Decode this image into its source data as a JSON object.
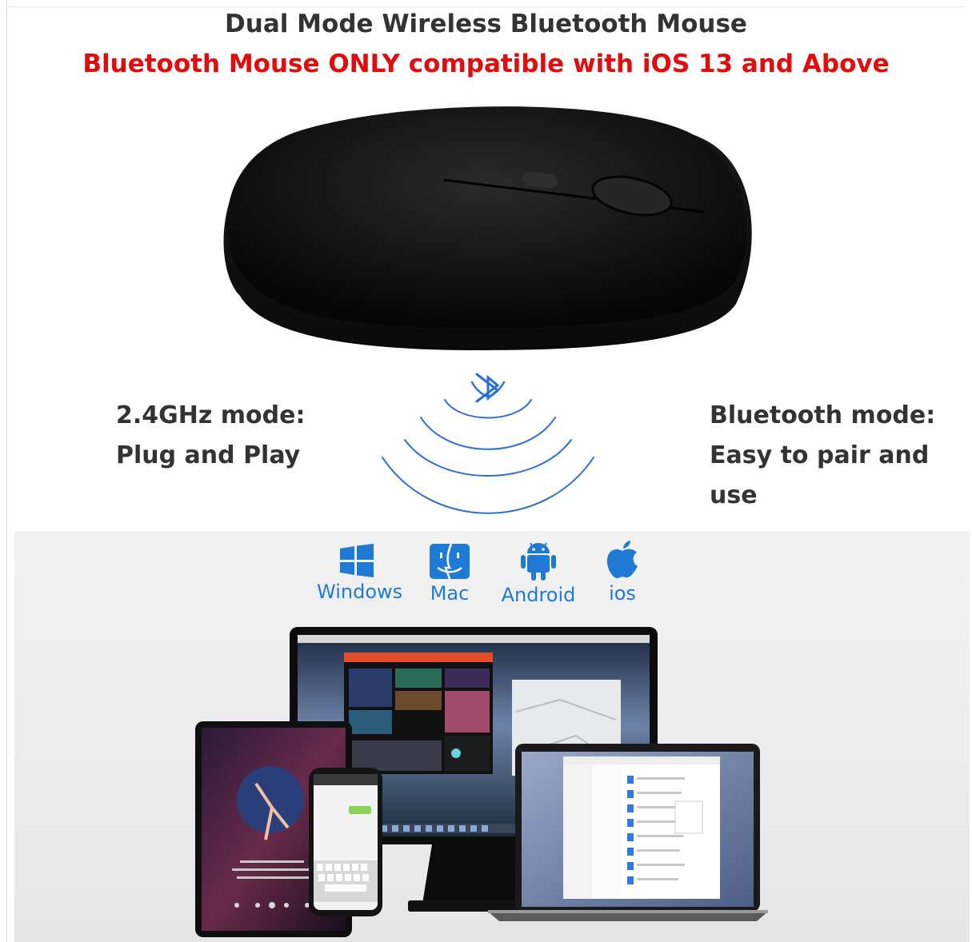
{
  "header": {
    "title": "Dual Mode Wireless Bluetooth Mouse",
    "compatibility_notice": "Bluetooth Mouse ONLY compatible with iOS 13 and Above"
  },
  "modes": {
    "left": {
      "line1": "2.4GHz mode:",
      "line2": "Plug and Play"
    },
    "right": {
      "line1": "Bluetooth mode:",
      "line2": "Easy to pair and use"
    }
  },
  "os_list": [
    {
      "label": "Windows",
      "icon": "windows-icon"
    },
    {
      "label": "Mac",
      "icon": "mac-finder-icon"
    },
    {
      "label": "Android",
      "icon": "android-icon"
    },
    {
      "label": "ios",
      "icon": "apple-icon"
    }
  ],
  "colors": {
    "title": "#333333",
    "notice": "#e30b0b",
    "os_blue": "#1f7ad6",
    "signal_blue": "#2b6fd6",
    "mouse_body": "#121212"
  },
  "devices": [
    "tablet",
    "smartphone",
    "desktop-monitor",
    "laptop"
  ]
}
